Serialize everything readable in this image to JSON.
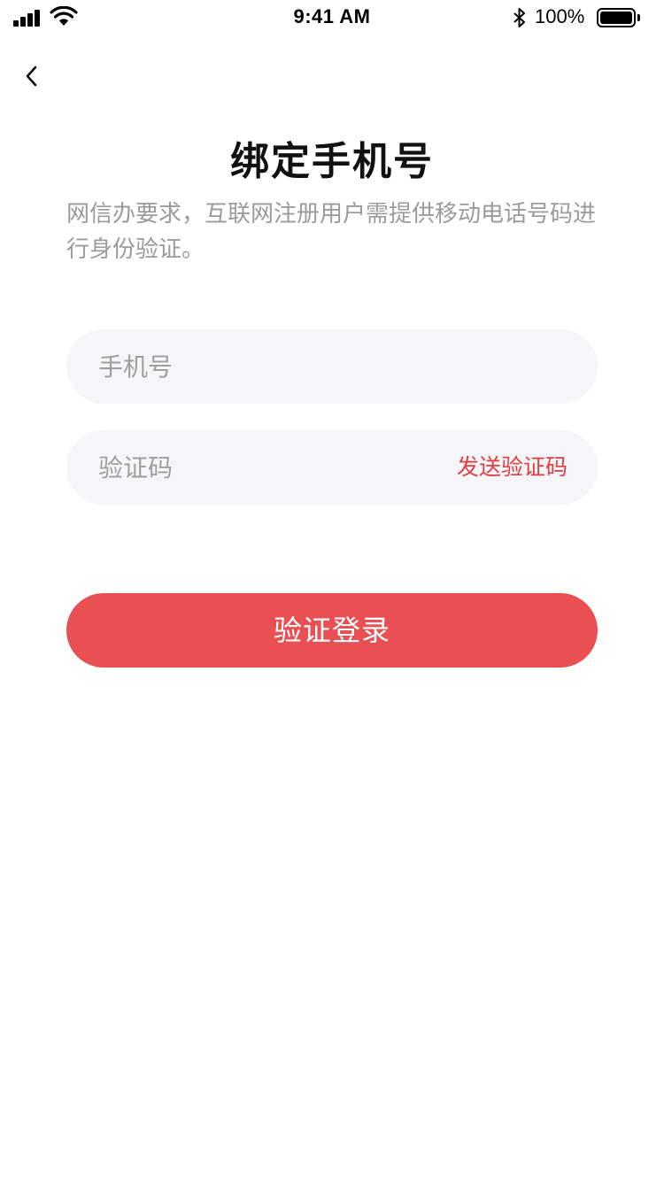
{
  "status_bar": {
    "time": "9:41 AM",
    "battery_text": "100%",
    "battery_level": 1.0,
    "signal_icon": "cellular-signal-icon",
    "wifi_icon": "wifi-icon",
    "bluetooth_icon": "bluetooth-icon",
    "battery_icon": "battery-icon"
  },
  "nav": {
    "back_icon": "chevron-left-icon"
  },
  "header": {
    "title": "绑定手机号",
    "subtitle": "网信办要求，互联网注册用户需提供移动电话号码进行身份验证。"
  },
  "form": {
    "phone_placeholder": "手机号",
    "code_placeholder": "验证码",
    "send_code_label": "发送验证码",
    "submit_label": "验证登录"
  },
  "colors": {
    "accent": "#e85054",
    "link": "#e33d42",
    "input_bg": "#f6f6f8",
    "subtitle": "#9b9b9b"
  }
}
